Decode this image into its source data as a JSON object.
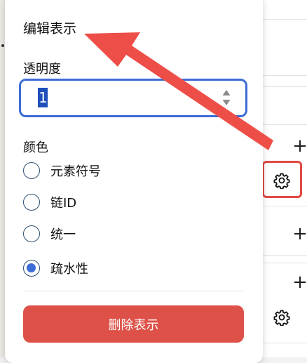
{
  "popover": {
    "title": "编辑表示",
    "opacity_label": "透明度",
    "opacity_value": "1",
    "color_label": "颜色",
    "color_options": [
      {
        "label": "元素符号",
        "checked": false
      },
      {
        "label": "链ID",
        "checked": false
      },
      {
        "label": "统一",
        "checked": false
      },
      {
        "label": "疏水性",
        "checked": true
      }
    ],
    "delete_button": "删除表示"
  },
  "background": {
    "plus_icon": "+",
    "gear_icon": "gear-icon"
  },
  "colors": {
    "accent": "#3d6cd6",
    "danger": "#de5148",
    "highlight": "#e24a44"
  }
}
